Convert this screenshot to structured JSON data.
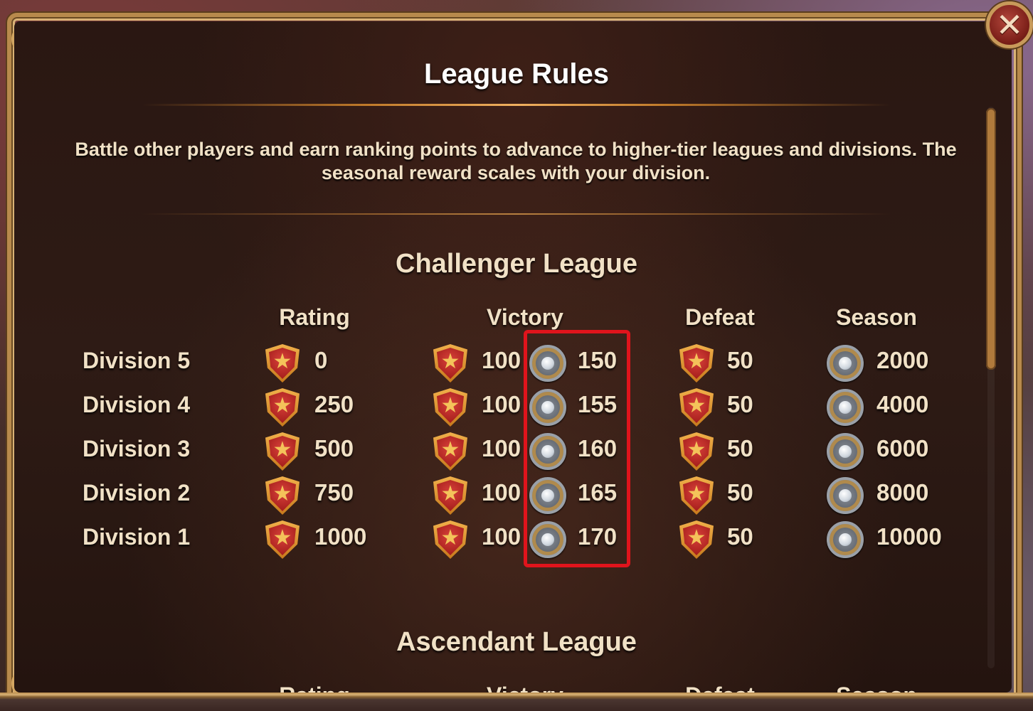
{
  "dialog": {
    "title": "League Rules",
    "close_icon": "close-icon",
    "description": "Battle other players and earn ranking points to advance to higher-tier leagues and divisions. The seasonal reward scales with your division."
  },
  "columns": [
    "Rating",
    "Victory",
    "Defeat",
    "Season"
  ],
  "icons": {
    "rating": "shield-icon",
    "victory_points": "shield-icon",
    "victory_reward": "silver-coin-icon",
    "defeat": "shield-icon",
    "season": "silver-coin-icon"
  },
  "leagues": [
    {
      "name": "Challenger League",
      "divisions": [
        {
          "label": "Division 5",
          "rating": "0",
          "victory_points": "100",
          "victory_reward": "150",
          "defeat": "50",
          "season": "2000"
        },
        {
          "label": "Division 4",
          "rating": "250",
          "victory_points": "100",
          "victory_reward": "155",
          "defeat": "50",
          "season": "4000"
        },
        {
          "label": "Division 3",
          "rating": "500",
          "victory_points": "100",
          "victory_reward": "160",
          "defeat": "50",
          "season": "6000"
        },
        {
          "label": "Division 2",
          "rating": "750",
          "victory_points": "100",
          "victory_reward": "165",
          "defeat": "50",
          "season": "8000"
        },
        {
          "label": "Division 1",
          "rating": "1000",
          "victory_points": "100",
          "victory_reward": "170",
          "defeat": "50",
          "season": "10000"
        }
      ]
    },
    {
      "name": "Ascendant League",
      "divisions": []
    }
  ],
  "colors": {
    "panel_bg": "#2a1712",
    "frame_gold": "#b88a4c",
    "text": "#f1e1c6",
    "highlight": "#e0141c",
    "close_button": "#9b2c22"
  }
}
